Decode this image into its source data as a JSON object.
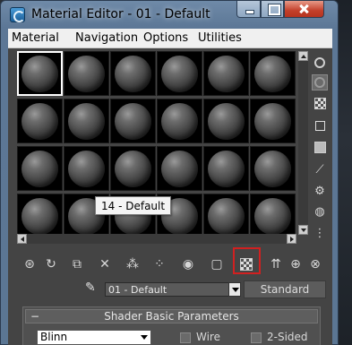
{
  "window": {
    "title": "Material Editor - 01 - Default"
  },
  "menubar": {
    "items": [
      "Material",
      "Navigation",
      "Options",
      "Utilities"
    ]
  },
  "slots": {
    "count": 24,
    "active_index": 0
  },
  "tooltip": {
    "text": "14 - Default"
  },
  "side_toolbar": {
    "icons": [
      "sample-type-icon",
      "backlight-icon",
      "background-icon",
      "uv-tiling-icon",
      "video-color-check-icon",
      "make-preview-icon",
      "options-icon",
      "select-by-material-icon",
      "material-map-navigator-icon"
    ]
  },
  "bottom_toolbar": {
    "icons": [
      "get-material-icon",
      "put-to-scene-icon",
      "assign-to-selection-icon",
      "reset-map-icon",
      "make-unique-icon",
      "put-to-library-icon",
      "material-id-channel-icon",
      "show-shaded-in-viewport-icon",
      "show-end-result-icon",
      "go-to-parent-icon",
      "go-forward-sibling-icon",
      "extra-icon"
    ],
    "highlighted": "show-end-result-icon"
  },
  "material": {
    "name": "01 - Default",
    "type_button": "Standard"
  },
  "rollout": {
    "toggle": "−",
    "title": "Shader Basic Parameters",
    "shader": "Blinn",
    "wire_label": "Wire",
    "two_sided_label": "2-Sided"
  },
  "colors": {
    "title_gradient_top": "#6f8aa8",
    "client_bg": "#444444",
    "highlight": "#d12020"
  }
}
